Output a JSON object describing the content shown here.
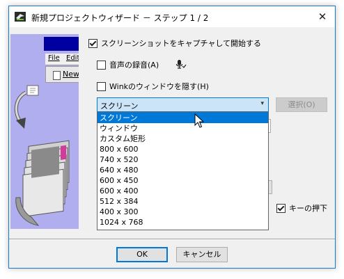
{
  "window": {
    "title": "新規プロジェクトウィザード － ステップ 1 / 2",
    "close_glyph": "✕"
  },
  "illustration": {
    "menu_file": "File",
    "menu_edit": "Edit",
    "toolbar_new": "New..."
  },
  "options": {
    "start_capture_label": "スクリーンショットをキャプチャして開始する",
    "start_capture_checked": true,
    "record_audio_label": "音声の録音(A)",
    "record_audio_checked": false,
    "hide_wink_label": "Winkのウィンドウを隠す(H)",
    "hide_wink_checked": false,
    "key_press_label": "キーの押下",
    "key_press_checked": true
  },
  "capture_target": {
    "selected": "スクリーン",
    "options": [
      "スクリーン",
      "ウィンドウ",
      "カスタム矩形",
      "800 x 600",
      "740 x 520",
      "640 x 480",
      "600 x 450",
      "600 x 400",
      "512 x 384",
      "400 x 300",
      "1024 x 768"
    ],
    "select_button_label": "選択(O)",
    "select_button_enabled": false
  },
  "footer": {
    "ok_label": "OK",
    "cancel_label": "キャンセル"
  },
  "icons": {
    "app": "app-icon",
    "close": "close-icon",
    "microphone": "microphone-icon",
    "dropdown": "chevron-down-icon",
    "cursor": "mouse-cursor-icon"
  },
  "colors": {
    "accent": "#0078d7",
    "window_border": "#1979ca",
    "illustration_bg": "#b0aeee",
    "illustration_bar": "#0000a0"
  }
}
